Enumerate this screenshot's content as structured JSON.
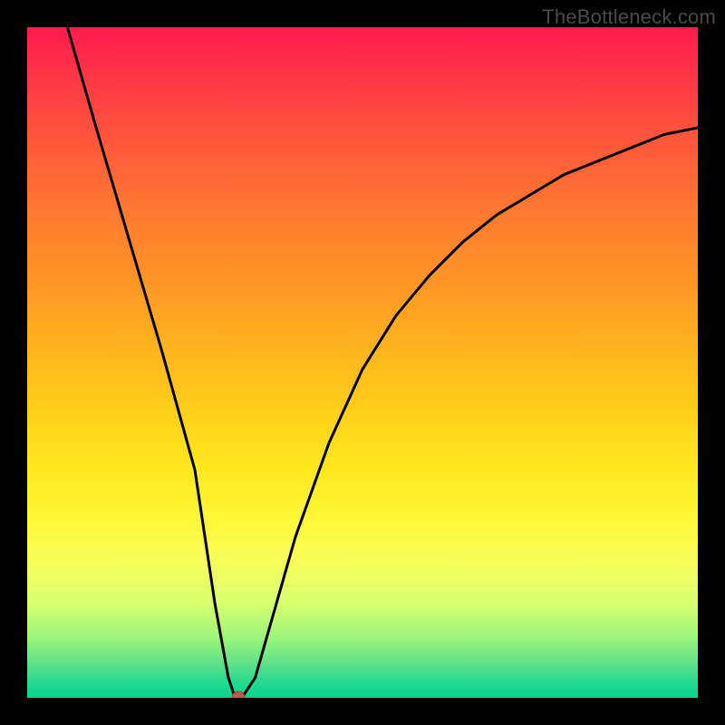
{
  "watermark": "TheBottleneck.com",
  "chart_data": {
    "type": "line",
    "title": "",
    "xlabel": "",
    "ylabel": "",
    "xlim": [
      0,
      100
    ],
    "ylim": [
      0,
      100
    ],
    "grid": false,
    "legend": false,
    "series": [
      {
        "name": "bottleneck-curve",
        "x": [
          6,
          10,
          15,
          20,
          25,
          28,
          30,
          31,
          32,
          34,
          36,
          40,
          45,
          50,
          55,
          60,
          65,
          70,
          75,
          80,
          85,
          90,
          95,
          100
        ],
        "y": [
          100,
          86,
          69,
          52,
          34,
          14,
          3,
          0,
          0,
          3,
          10,
          24,
          38,
          49,
          57,
          63,
          68,
          72,
          75,
          78,
          80,
          82,
          84,
          85
        ]
      }
    ],
    "markers": [
      {
        "name": "min-point-dot",
        "x": 31.5,
        "y": 0,
        "color": "#c05a4a",
        "radius_px": 7
      }
    ],
    "background_gradient": {
      "direction": "vertical",
      "stops": [
        {
          "pos": 0.0,
          "color": "#ff1a4d"
        },
        {
          "pos": 0.5,
          "color": "#ffd21a"
        },
        {
          "pos": 0.8,
          "color": "#f8ff5c"
        },
        {
          "pos": 1.0,
          "color": "#0ad48e"
        }
      ]
    }
  }
}
